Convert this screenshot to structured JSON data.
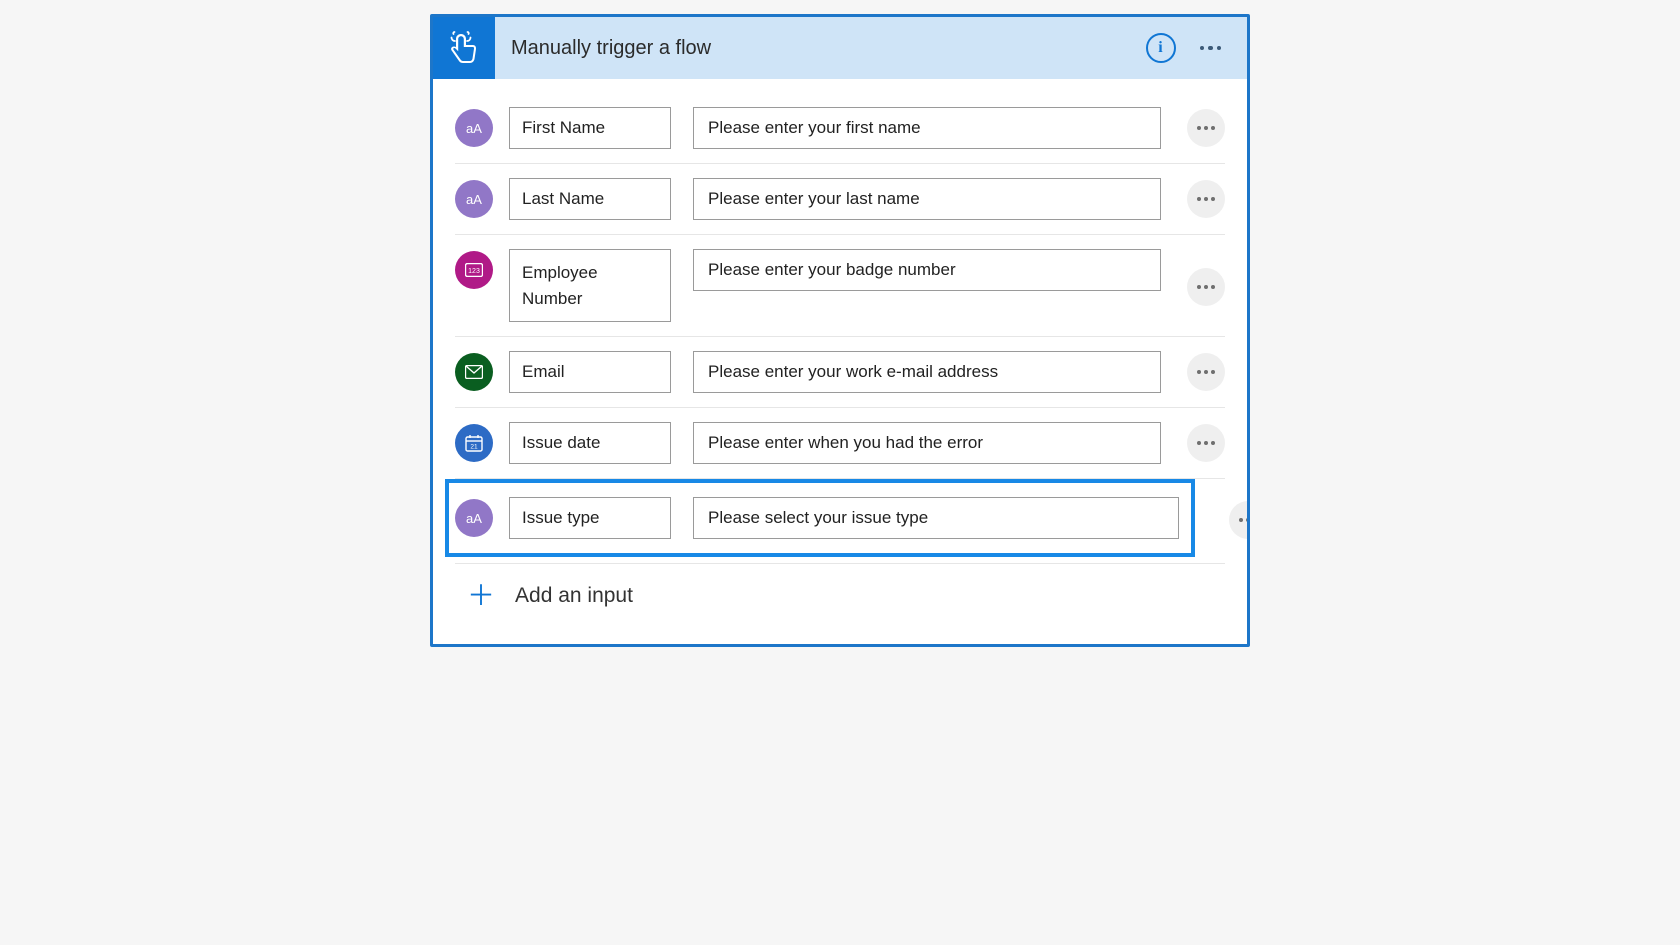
{
  "header": {
    "title": "Manually trigger a flow"
  },
  "rows": [
    {
      "icon": "text",
      "name": "First Name",
      "placeholder": "Please enter your first name"
    },
    {
      "icon": "text",
      "name": "Last Name",
      "placeholder": "Please enter your last name"
    },
    {
      "icon": "number",
      "name": "Employee Number",
      "placeholder": "Please enter your badge number"
    },
    {
      "icon": "email",
      "name": "Email",
      "placeholder": "Please enter your work e-mail address"
    },
    {
      "icon": "date",
      "name": "Issue date",
      "placeholder": "Please enter when you had the error"
    },
    {
      "icon": "text",
      "name": "Issue type",
      "placeholder": "Please select your issue type"
    }
  ],
  "footer": {
    "add_input": "Add an input"
  },
  "colors": {
    "primary": "#1076d4",
    "header_bg": "#cfe4f7",
    "highlight": "#1889e6"
  }
}
